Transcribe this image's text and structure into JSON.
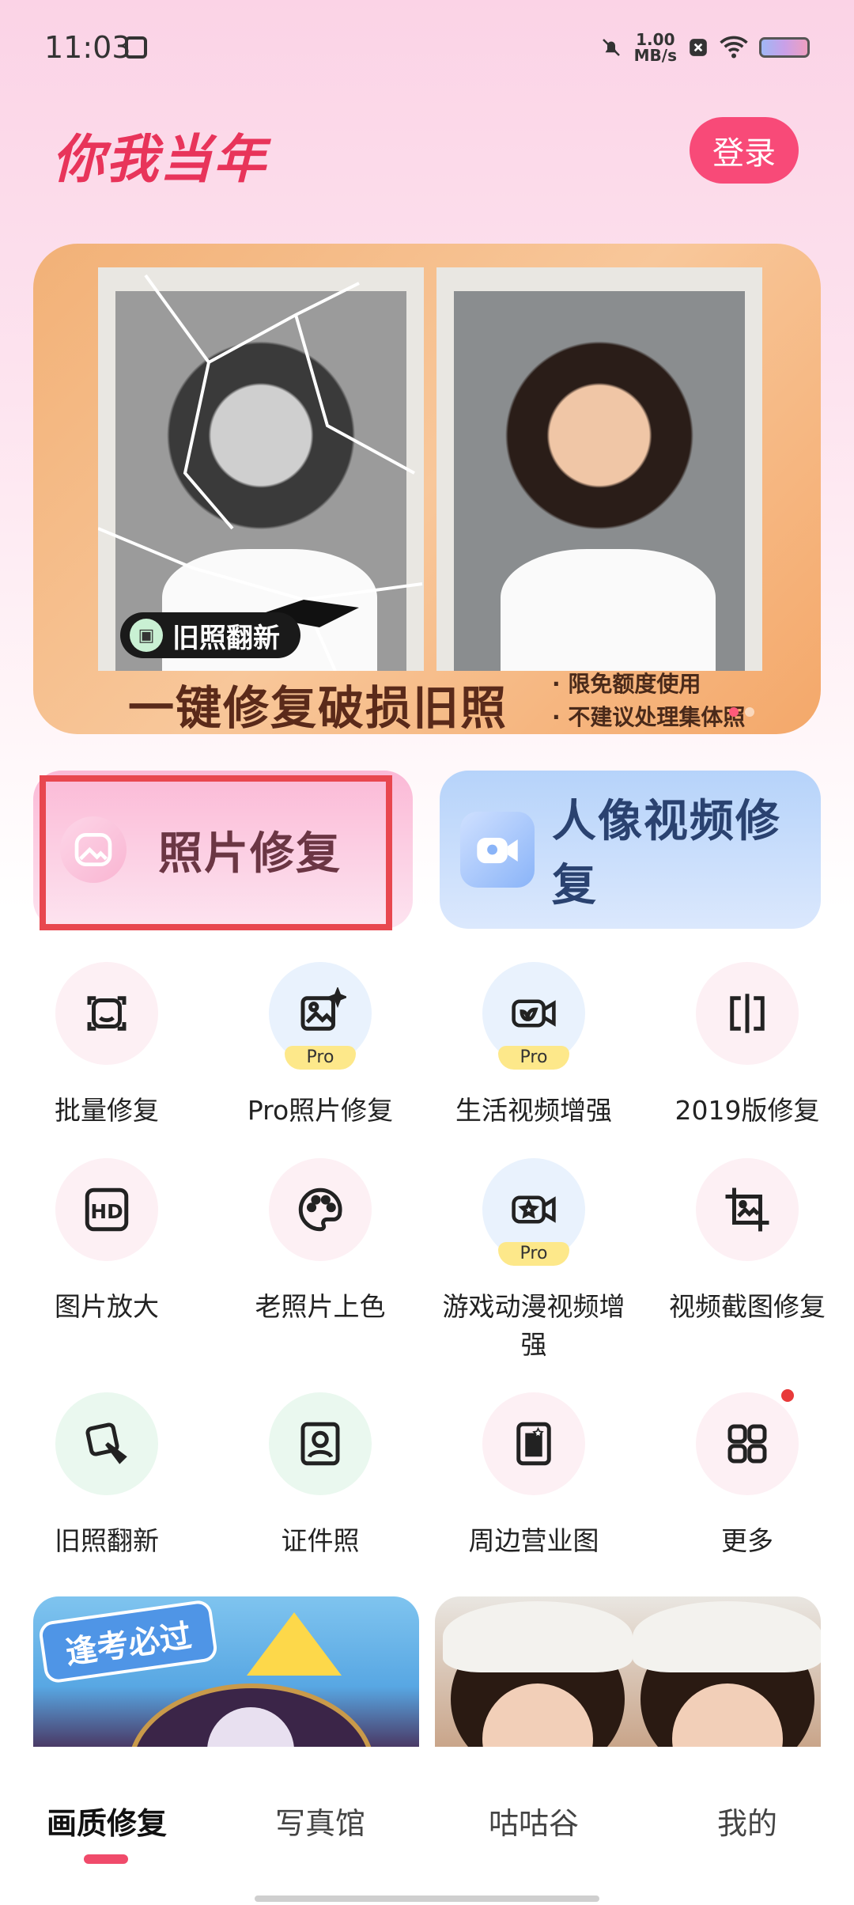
{
  "status_bar": {
    "time": "11:03",
    "speed_value": "1.00",
    "speed_unit": "MB/s"
  },
  "header": {
    "brand": "你我当年",
    "login_label": "登录"
  },
  "banner": {
    "tag": "旧照翻新",
    "title": "一键修复破损旧照",
    "notes": [
      "· 限免额度使用",
      "· 不建议处理集体照"
    ]
  },
  "features": {
    "photo_repair": "照片修复",
    "portrait_video": "人像视频修复"
  },
  "tools": [
    {
      "label": "批量修复",
      "icon": "face-scan-icon",
      "pro": false
    },
    {
      "label": "Pro照片修复",
      "icon": "image-sparkle-icon",
      "pro": true,
      "badge": "Pro"
    },
    {
      "label": "生活视频增强",
      "icon": "video-leaf-icon",
      "pro": true,
      "badge": "Pro"
    },
    {
      "label": "2019版修复",
      "icon": "compare-icon",
      "pro": false
    },
    {
      "label": "图片放大",
      "icon": "hd-icon",
      "pro": false
    },
    {
      "label": "老照片上色",
      "icon": "palette-icon",
      "pro": false
    },
    {
      "label": "游戏动漫视频增强",
      "icon": "video-star-icon",
      "pro": true,
      "badge": "Pro"
    },
    {
      "label": "视频截图修复",
      "icon": "crop-image-icon",
      "pro": false
    },
    {
      "label": "旧照翻新",
      "icon": "brush-photo-icon",
      "pro": false
    },
    {
      "label": "证件照",
      "icon": "id-photo-icon",
      "pro": false
    },
    {
      "label": "周边营业图",
      "icon": "star-card-icon",
      "pro": false
    },
    {
      "label": "更多",
      "icon": "grid-icon",
      "pro": false
    }
  ],
  "promo": {
    "exam_badge": "逢考必过"
  },
  "bottom_nav": [
    "画质修复",
    "写真馆",
    "咕咕谷",
    "我的"
  ],
  "colors": {
    "accent": "#f84a78",
    "selection": "#e8474f",
    "pro_badge": "#fde88a"
  }
}
